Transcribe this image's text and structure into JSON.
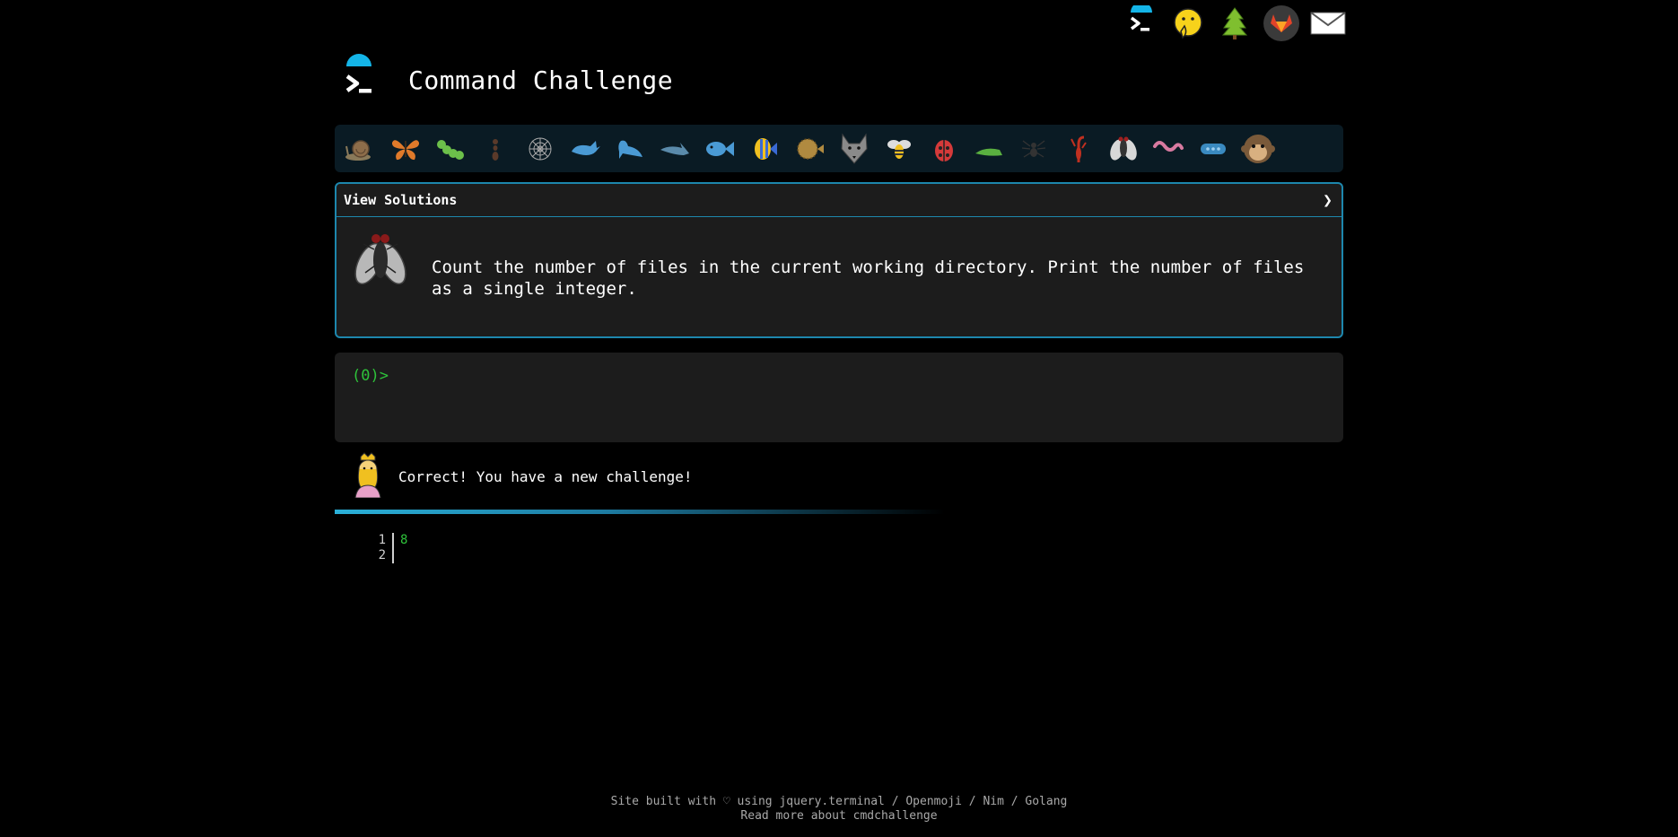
{
  "app": {
    "title": "Command Challenge"
  },
  "topnav": {
    "items": [
      {
        "name": "terminal-logo-icon"
      },
      {
        "name": "face-with-hand-over-mouth-icon"
      },
      {
        "name": "tree-icon"
      },
      {
        "name": "gitlab-icon"
      },
      {
        "name": "envelope-icon"
      }
    ]
  },
  "levels": [
    "snail",
    "butterfly",
    "caterpillar",
    "ant",
    "spider-web",
    "whale",
    "shark",
    "dolphin",
    "fish",
    "tropical-fish",
    "blowfish",
    "wolf",
    "bee",
    "ladybug",
    "cricket",
    "spider",
    "scorpion",
    "fly",
    "worm",
    "microbe",
    "monkey"
  ],
  "challenge": {
    "header_label": "View Solutions",
    "chevron": "❯",
    "description": "Count the number of files in the current working directory. Print the number of files as a single integer."
  },
  "terminal": {
    "prompt": "(0)>"
  },
  "result": {
    "message": "Correct! You have a new challenge!"
  },
  "output": {
    "lines": [
      {
        "num": "1",
        "text": "8"
      },
      {
        "num": "2",
        "text": ""
      }
    ]
  },
  "footer": {
    "line1": "Site built with ♡ using jquery.terminal / Openmoji / Nim / Golang",
    "line2": "Read more about cmdchallenge"
  },
  "colors": {
    "accent": "#1d87ad",
    "prompt_green": "#2ec23a",
    "panel_bg": "#1c1c1c",
    "levelbar_bg": "#0a1b24"
  }
}
